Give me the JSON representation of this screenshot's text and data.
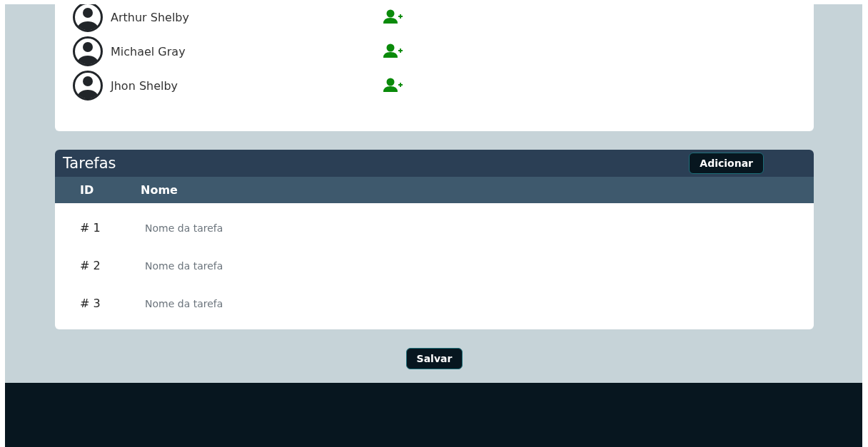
{
  "members": [
    {
      "name": "Arthur Shelby"
    },
    {
      "name": "Michael Gray"
    },
    {
      "name": "Jhon Shelby"
    }
  ],
  "tasks": {
    "title": "Tarefas",
    "add_button": "Adicionar",
    "columns": [
      "ID",
      "Nome"
    ],
    "rows": [
      {
        "id": "# 1",
        "placeholder": "Nome da tarefa"
      },
      {
        "id": "# 2",
        "placeholder": "Nome da tarefa"
      },
      {
        "id": "# 3",
        "placeholder": "Nome da tarefa"
      }
    ]
  },
  "save_button": "Salvar"
}
